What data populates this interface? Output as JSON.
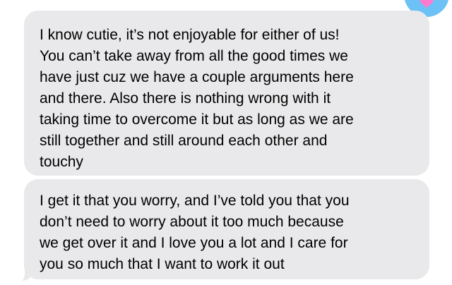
{
  "messages": [
    {
      "lines": [
        "I know cutie, it’s not enjoyable for either of us!",
        "You can’t take away from all the good times we",
        "have just cuz we have a couple arguments here",
        "and there. Also there is nothing wrong with it",
        "taking time to overcome it but as long as we are",
        "still together and still around each other and",
        "touchy"
      ]
    },
    {
      "lines": [
        "I get it that you worry, and I’ve told you that you",
        "don’t need to worry about it too much because",
        "we get over it and I love you a lot and I care for",
        "you so much that I want to work it out"
      ]
    }
  ],
  "reaction": {
    "icon": "heart-icon",
    "color": "#ff7ad1"
  },
  "colors": {
    "bubble": "#e9e9eb",
    "text": "#000000",
    "avatar": "#6cc2f4"
  }
}
